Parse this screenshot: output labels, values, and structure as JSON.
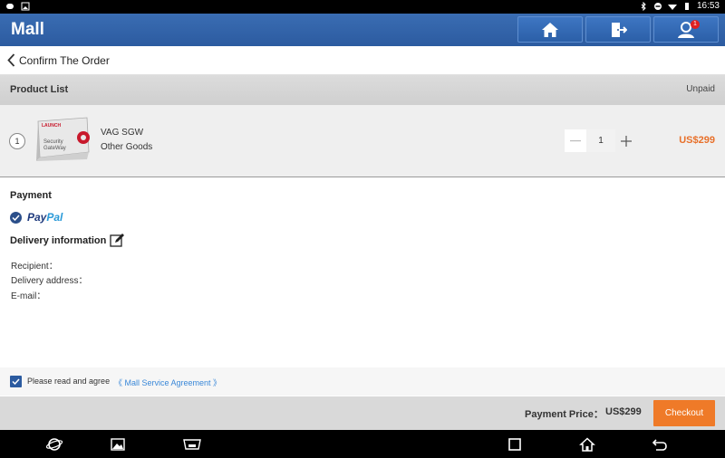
{
  "status_bar": {
    "time": "16:53"
  },
  "header": {
    "title": "Mall",
    "notification_count": "1"
  },
  "confirm": {
    "back_label": "Confirm The Order"
  },
  "product_list": {
    "title": "Product List",
    "status": "Unpaid",
    "items": [
      {
        "index": "1",
        "name": "VAG SGW",
        "category": "Other Goods",
        "quantity": "1",
        "price": "US$299",
        "image_text": {
          "brand": "LAUNCH",
          "line1": "Security",
          "line2": "GateWay"
        }
      }
    ]
  },
  "payment": {
    "title": "Payment",
    "method_part1": "Pay",
    "method_part2": "Pal"
  },
  "delivery": {
    "title": "Delivery information",
    "recipient_label": "Recipient：",
    "address_label": "Delivery address：",
    "email_label": "E-mail："
  },
  "agreement": {
    "text": "Please read and agree",
    "link": "《 Mall Service Agreement 》"
  },
  "footer": {
    "price_label": "Payment Price：",
    "price_value": "US$299",
    "checkout_label": "Checkout"
  },
  "colors": {
    "header_blue": "#2c5ba0",
    "price_orange": "#e8702a",
    "checkout_orange": "#ef7a28",
    "link_blue": "#3a88d8"
  }
}
